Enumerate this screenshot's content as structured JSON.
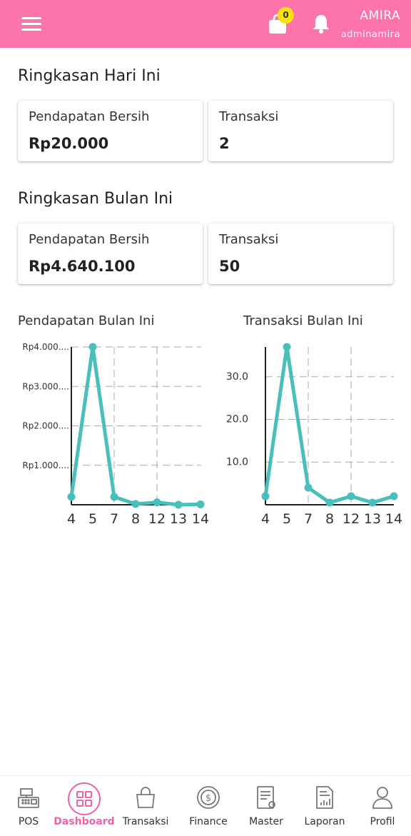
{
  "header": {
    "user_name": "AMIRA",
    "user_handle": "adminamira",
    "cart_count": "0",
    "bg_color": "#fd74ad"
  },
  "today": {
    "title": "Ringkasan Hari Ini",
    "revenue_label": "Pendapatan Bersih",
    "revenue_value": "Rp20.000",
    "trans_label": "Transaksi",
    "trans_value": "2"
  },
  "month": {
    "title": "Ringkasan Bulan Ini",
    "revenue_label": "Pendapatan Bersih",
    "revenue_value": "Rp4.640.100",
    "trans_label": "Transaksi",
    "trans_value": "50"
  },
  "chart_data": [
    {
      "type": "line",
      "title": "Pendapatan Bulan Ini",
      "categories": [
        "4",
        "5",
        "7",
        "8",
        "12",
        "13",
        "14"
      ],
      "values": [
        200000,
        4000000,
        200000,
        20000,
        60000,
        0,
        10000
      ],
      "ytick_labels": [
        "Rp1.000....",
        "Rp2.000....",
        "Rp3.000....",
        "Rp4.000...."
      ],
      "yticks": [
        1000000,
        2000000,
        3000000,
        4000000
      ],
      "ylim": [
        0,
        4000000
      ],
      "grid": true,
      "color": "#48bfba"
    },
    {
      "type": "line",
      "title": "Transaksi Bulan Ini",
      "categories": [
        "4",
        "5",
        "7",
        "8",
        "12",
        "13",
        "14"
      ],
      "values": [
        2,
        37,
        4,
        0.5,
        2,
        0.5,
        2
      ],
      "ytick_labels": [
        "10.0",
        "20.0",
        "30.0"
      ],
      "yticks": [
        10,
        20,
        30
      ],
      "ylim": [
        0,
        37
      ],
      "grid": true,
      "color": "#48bfba"
    }
  ],
  "nav": {
    "items": [
      {
        "label": "POS",
        "icon": "cash-register-icon"
      },
      {
        "label": "Dashboard",
        "icon": "dashboard-grid-icon"
      },
      {
        "label": "Transaksi",
        "icon": "shopping-bag-icon"
      },
      {
        "label": "Finance",
        "icon": "dollar-coin-icon"
      },
      {
        "label": "Master",
        "icon": "document-gear-icon"
      },
      {
        "label": "Laporan",
        "icon": "report-chart-icon"
      },
      {
        "label": "Profil",
        "icon": "user-icon"
      }
    ],
    "active_color": "#f062a8"
  }
}
